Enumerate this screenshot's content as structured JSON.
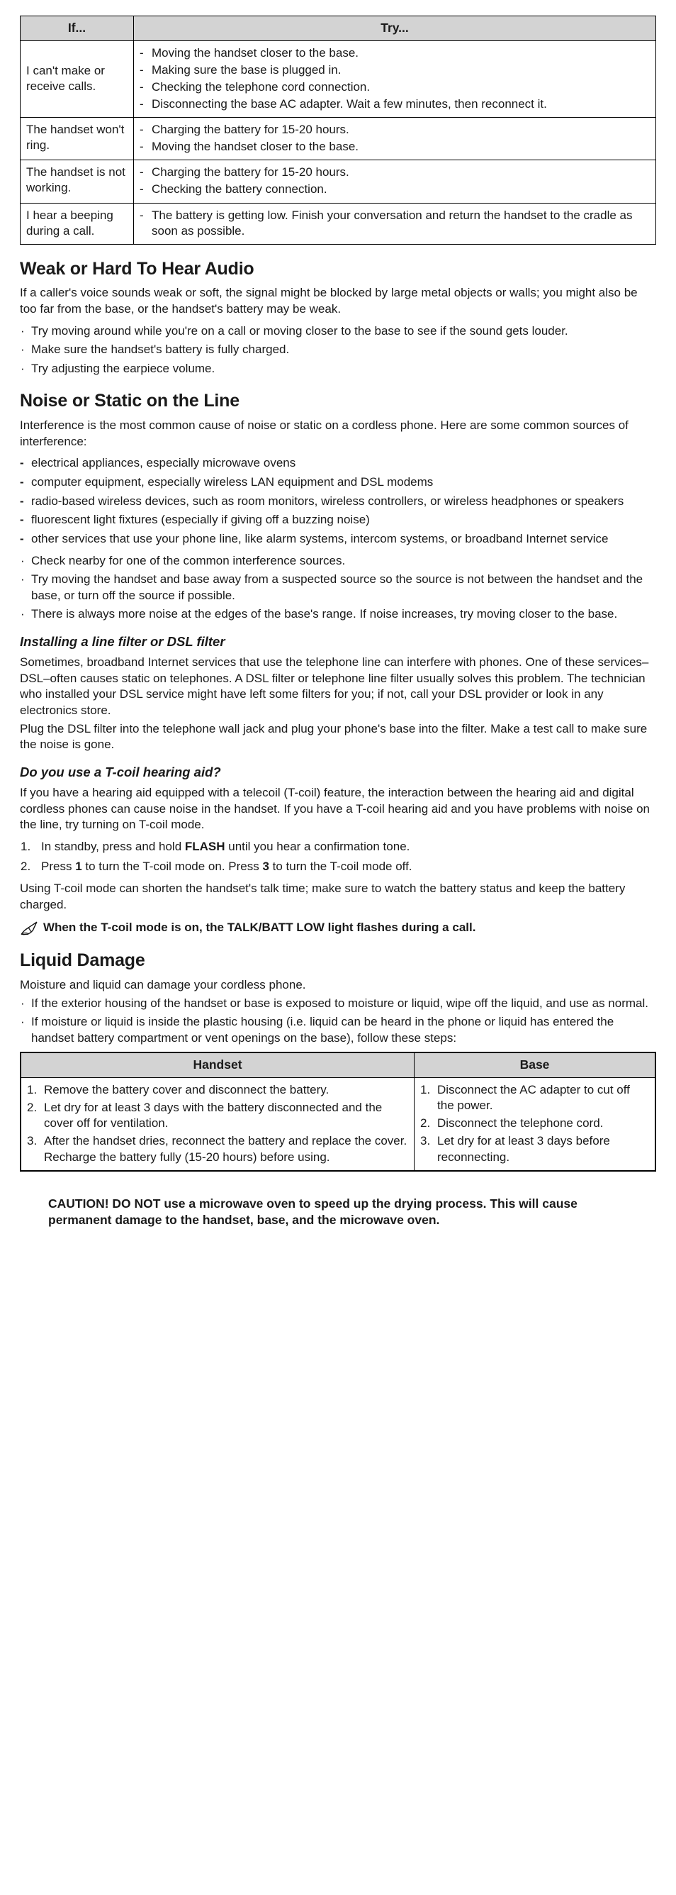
{
  "troubleshooting_table": {
    "headers": [
      "If...",
      "Try..."
    ],
    "rows": [
      {
        "if": "I can't make or receive calls.",
        "try": [
          "Moving the handset closer to the base.",
          "Making sure the base is plugged in.",
          "Checking the telephone cord connection.",
          "Disconnecting the base AC adapter. Wait a few minutes, then reconnect it."
        ]
      },
      {
        "if": "The handset won't ring.",
        "try": [
          "Charging the battery for 15-20 hours.",
          "Moving the handset closer to the base."
        ]
      },
      {
        "if": "The handset is not working.",
        "try": [
          "Charging the battery for 15-20 hours.",
          "Checking the battery connection."
        ]
      },
      {
        "if": "I hear a beeping during a call.",
        "try": [
          "The battery is getting low. Finish your conversation and return the handset to the cradle as soon as possible."
        ]
      }
    ],
    "dash_marker": "-"
  },
  "weak_audio": {
    "title": "Weak or Hard To Hear Audio",
    "intro": "If a caller's voice sounds weak or soft, the signal might be blocked by large metal objects or walls; you might also be too far from the base, or the handset's battery may be weak.",
    "bullet_marker": "·",
    "bullets": [
      "Try moving around while you're on a call or moving closer to the base to see if the sound gets louder.",
      "Make sure the handset's battery is fully charged.",
      "Try adjusting the earpiece volume."
    ]
  },
  "noise_static": {
    "title": "Noise or Static on the Line",
    "intro": "Interference is the most common cause of noise or static on a cordless phone. Here are some common sources of interference:",
    "dash_marker": "-",
    "bullet_marker": "·",
    "sources": [
      "electrical appliances, especially microwave ovens",
      "computer equipment, especially wireless LAN equipment and DSL modems",
      "radio-based wireless devices, such as room monitors, wireless controllers, or wireless headphones or speakers",
      "fluorescent light fixtures (especially if giving off a buzzing noise)",
      "other services that use your phone line, like alarm systems, intercom systems, or broadband Internet service"
    ],
    "tips": [
      "Check nearby for one of the common interference sources.",
      "Try moving the handset and base away from a suspected source so the source is not between the handset and the base, or turn off the source if possible.",
      "There is always more noise at the edges of the base's range. If noise increases, try moving closer to the base."
    ]
  },
  "line_filter": {
    "title": "Installing a line filter or DSL filter",
    "paragraph1": "Sometimes, broadband Internet services that use the telephone line can interfere with phones. One of these services–DSL–often causes static on telephones. A DSL filter or telephone line filter usually solves this problem. The technician who installed your DSL service might have left some filters for you; if not, call your DSL provider or look in any electronics store.",
    "paragraph2": "Plug the DSL filter into the telephone wall jack and plug your phone's base into the filter. Make a test call to make sure the noise is gone."
  },
  "tcoil": {
    "title": "Do you use a T-coil hearing aid?",
    "intro": "If you have a hearing aid equipped with a telecoil (T-coil) feature, the interaction between the hearing aid and digital cordless phones can cause noise in the handset. If you have a T-coil hearing aid and you have problems with noise on the line, try turning on T-coil mode.",
    "steps": [
      {
        "number": "1.",
        "parts": [
          {
            "text": "In standby, press and hold ",
            "bold": false
          },
          {
            "text": "FLASH",
            "bold": true
          },
          {
            "text": " until you hear a confirmation tone.",
            "bold": false
          }
        ]
      },
      {
        "number": "2.",
        "parts": [
          {
            "text": "Press ",
            "bold": false
          },
          {
            "text": "1",
            "bold": true
          },
          {
            "text": " to turn the T-coil mode on. Press ",
            "bold": false
          },
          {
            "text": "3",
            "bold": true
          },
          {
            "text": " to turn the T-coil mode off.",
            "bold": false
          }
        ]
      }
    ],
    "closing": "Using T-coil mode can shorten the handset's talk time; make sure to watch the battery status and keep the battery charged.",
    "note": "When the T-coil mode is on, the TALK/BATT LOW light flashes during a call.",
    "note_icon": "note-pencil-icon"
  },
  "liquid_damage": {
    "title": "Liquid Damage",
    "intro": "Moisture and liquid can damage your cordless phone.",
    "bullet_marker": "·",
    "bullets": [
      "If the exterior housing of the handset or base is exposed to moisture or liquid, wipe off the liquid, and use as normal.",
      "If moisture or liquid is inside the plastic housing (i.e. liquid can be heard in the phone or liquid has entered the handset battery compartment or vent openings on the base), follow these steps:"
    ],
    "table": {
      "headers": [
        "Handset",
        "Base"
      ],
      "handset_steps": [
        {
          "number": "1.",
          "text": "Remove the battery cover and disconnect the battery."
        },
        {
          "number": "2.",
          "text": "Let dry for at least 3 days with the battery disconnected and the cover off for ventilation."
        },
        {
          "number": "3.",
          "text": "After the handset dries, reconnect the battery and replace the cover. Recharge the battery fully (15-20 hours) before using."
        }
      ],
      "base_steps": [
        {
          "number": "1.",
          "text": "Disconnect the AC adapter to cut off the power."
        },
        {
          "number": "2.",
          "text": "Disconnect the telephone cord."
        },
        {
          "number": "3.",
          "text": "Let dry for at least 3 days before reconnecting."
        }
      ]
    }
  },
  "caution": {
    "lead": "CAUTION! DO NOT",
    "rest": " use a microwave oven to speed up the drying process. This will cause permanent damage to the handset, base, and the microwave oven."
  },
  "colors": {
    "table_header_bg": "#d3d3d3",
    "border": "#000000",
    "text": "#1a1a1a",
    "page_bg": "#ffffff"
  }
}
